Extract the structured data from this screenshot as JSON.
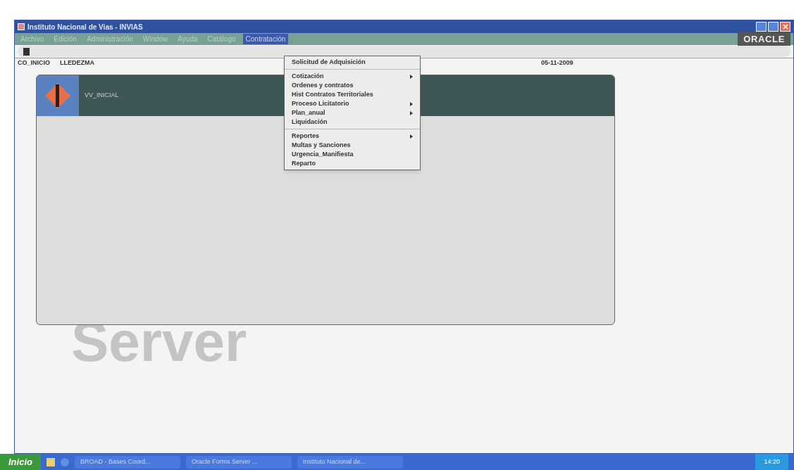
{
  "window": {
    "title": "Instituto Nacional de Vias - INVIAS"
  },
  "menu_bar": [
    {
      "label": "Archivo",
      "selected": false
    },
    {
      "label": "Edición",
      "selected": false
    },
    {
      "label": "Administración",
      "selected": false
    },
    {
      "label": "Window",
      "selected": false
    },
    {
      "label": "Ayuda",
      "selected": false
    },
    {
      "label": "Catálogo",
      "selected": false
    },
    {
      "label": "Contratación",
      "selected": true
    }
  ],
  "brand": "ORACLE",
  "status": {
    "form": "CO_INICIO",
    "user": "LLEDEZMA",
    "date": "05-11-2009"
  },
  "inner_window": {
    "title": "VV_INICIAL"
  },
  "background_text": "Server",
  "dropdown_groups": [
    [
      {
        "label": "Solicitud de Adquisición",
        "has_submenu": false
      }
    ],
    [
      {
        "label": "Cotización",
        "has_submenu": true
      },
      {
        "label": "Ordenes y contratos",
        "has_submenu": false
      },
      {
        "label": "Hist Contratos Territoriales",
        "has_submenu": false
      },
      {
        "label": "Proceso Licitatorio",
        "has_submenu": true
      },
      {
        "label": "Plan_anual",
        "has_submenu": true
      },
      {
        "label": "Liquidación",
        "has_submenu": false
      }
    ],
    [
      {
        "label": "Reportes",
        "has_submenu": true
      },
      {
        "label": "Multas y Sanciones",
        "has_submenu": false
      },
      {
        "label": "Urgencia_Manifiesta",
        "has_submenu": false
      },
      {
        "label": "Reparto",
        "has_submenu": false
      }
    ]
  ],
  "taskbar": {
    "start": "Inicio",
    "tasks": [
      "BROAD - Bases Coord...",
      "Oracle Forms Server ...",
      "Instituto Nacional de..."
    ],
    "clock": "14:20"
  }
}
